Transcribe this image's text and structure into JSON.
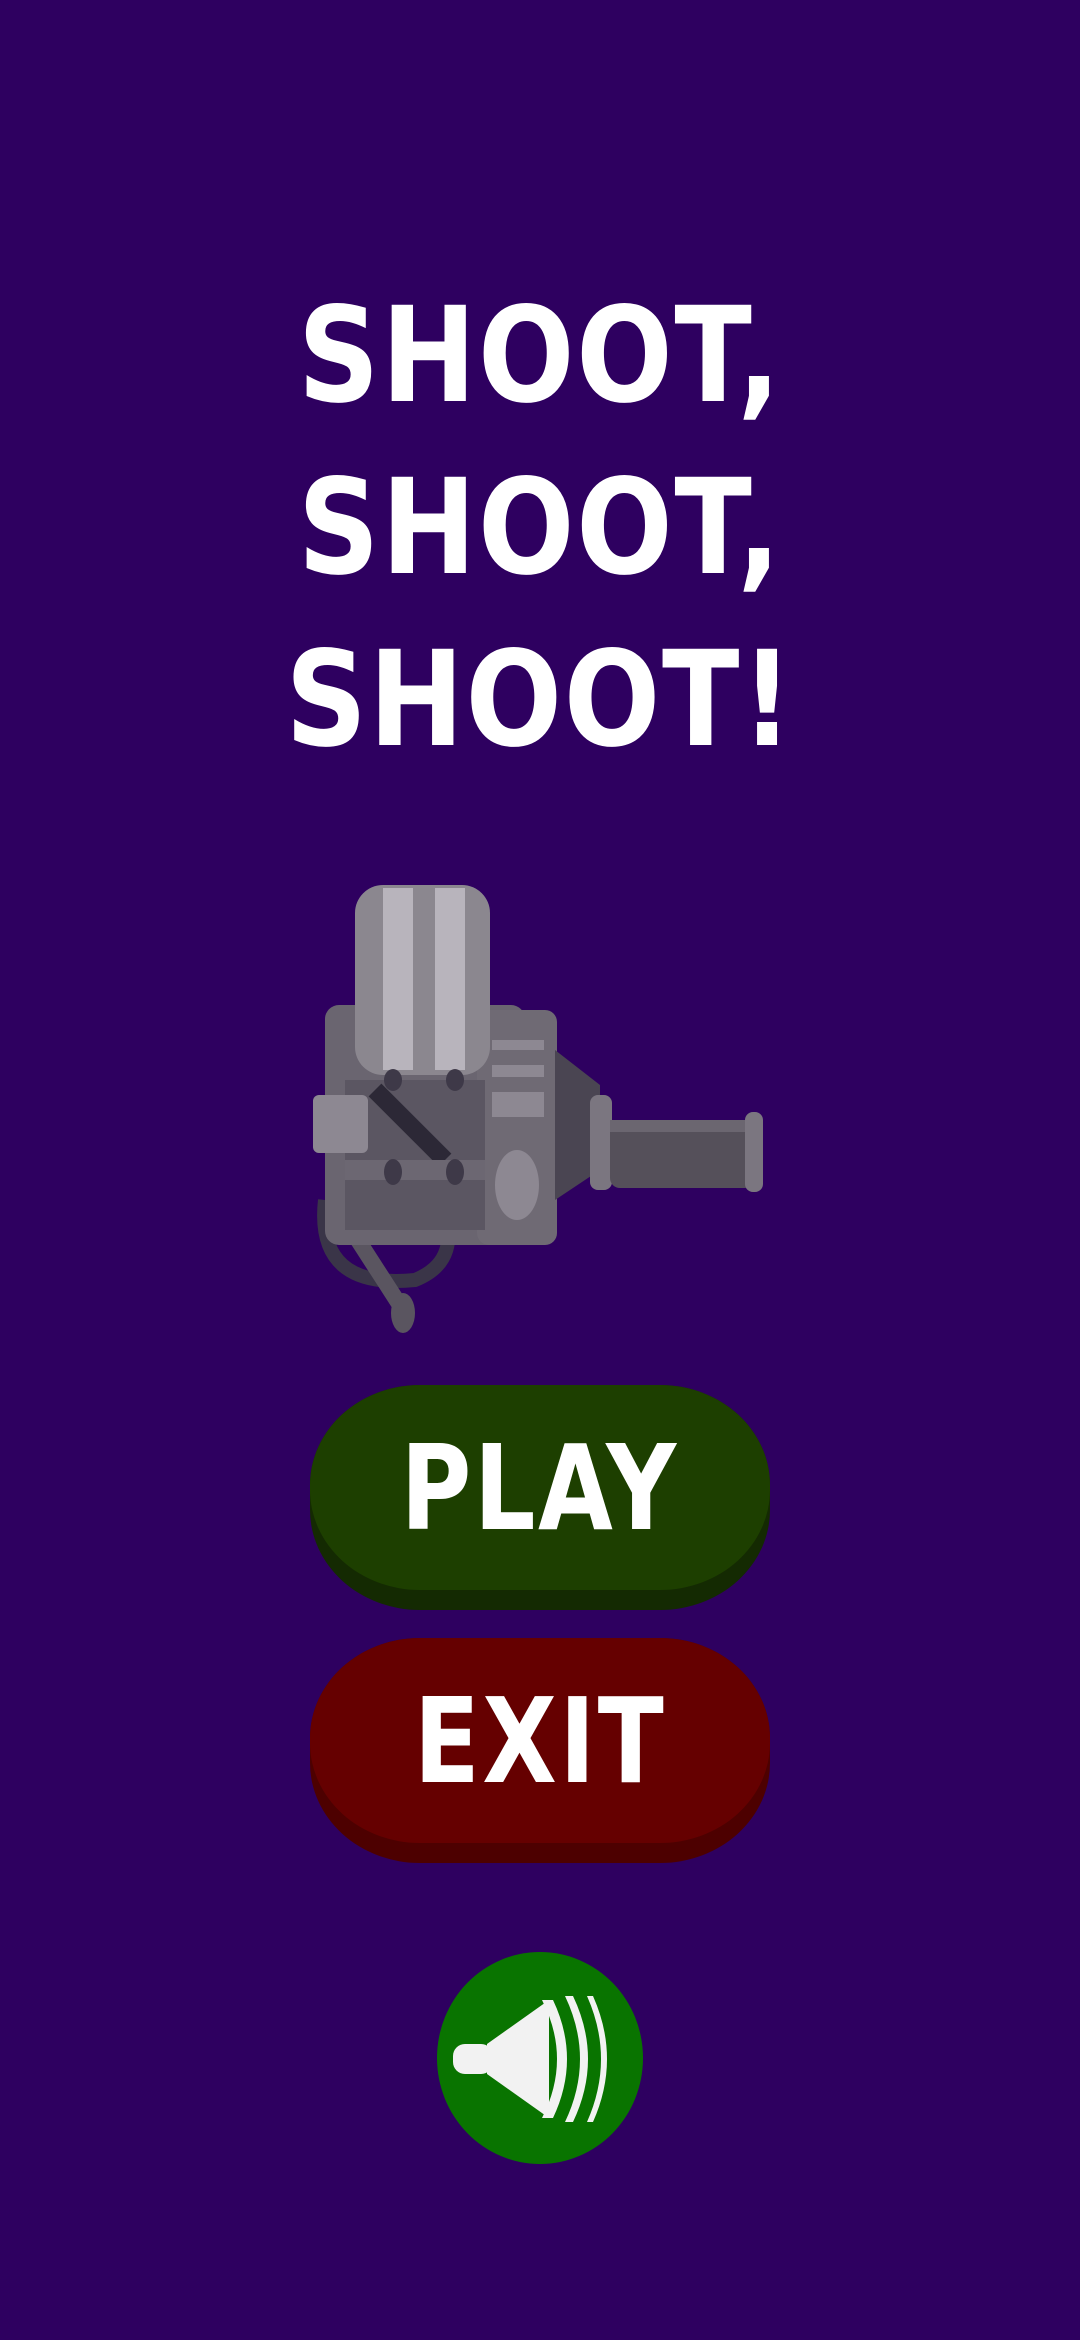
{
  "title": {
    "lines": [
      "SHOOT,",
      "SHOOT,",
      "SHOOT!"
    ]
  },
  "buttons": {
    "play_label": "PLAY",
    "exit_label": "EXIT"
  },
  "icons": {
    "hero": "gatling-gun-icon",
    "sound": "speaker-on-icon"
  },
  "colors": {
    "background": "#2e0060",
    "play_button": "#1d3f00",
    "exit_button": "#650000",
    "sound_button": "#097400",
    "text": "#ffffff"
  }
}
